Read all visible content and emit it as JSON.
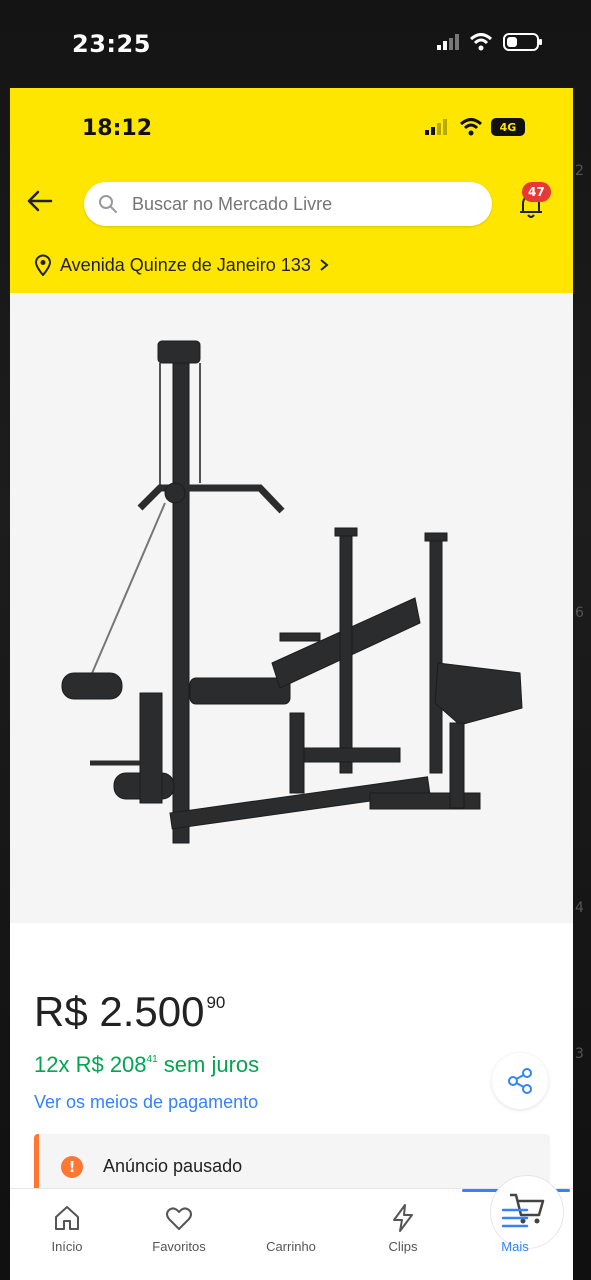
{
  "outer_status": {
    "time": "23:25"
  },
  "inner_status": {
    "time": "18:12",
    "network": "4G"
  },
  "header": {
    "search_placeholder": "Buscar no Mercado Livre",
    "notifications_count": "47",
    "address": "Avenida Quinze de Janeiro 133"
  },
  "product": {
    "price_main": "R$ 2.500",
    "price_cents": "90",
    "installments_prefix": "12x R$ 208",
    "installments_cents": "41",
    "installments_suffix": " sem juros",
    "payment_link": "Ver os meios de pagamento",
    "paused_label": "Anúncio pausado"
  },
  "tabbar": {
    "items": [
      {
        "label": "Início",
        "icon": "home-icon"
      },
      {
        "label": "Favoritos",
        "icon": "heart-icon"
      },
      {
        "label": "Carrinho",
        "icon": "cart-icon"
      },
      {
        "label": "Clips",
        "icon": "lightning-icon"
      },
      {
        "label": "Mais",
        "icon": "menu-icon"
      }
    ]
  },
  "colors": {
    "brand_yellow": "#fee600",
    "accent_blue": "#3483fa",
    "green": "#00a650",
    "warning_orange": "#ff7733",
    "badge_red": "#e53935"
  },
  "side_numbers": [
    "2",
    "6",
    "4",
    "3"
  ]
}
